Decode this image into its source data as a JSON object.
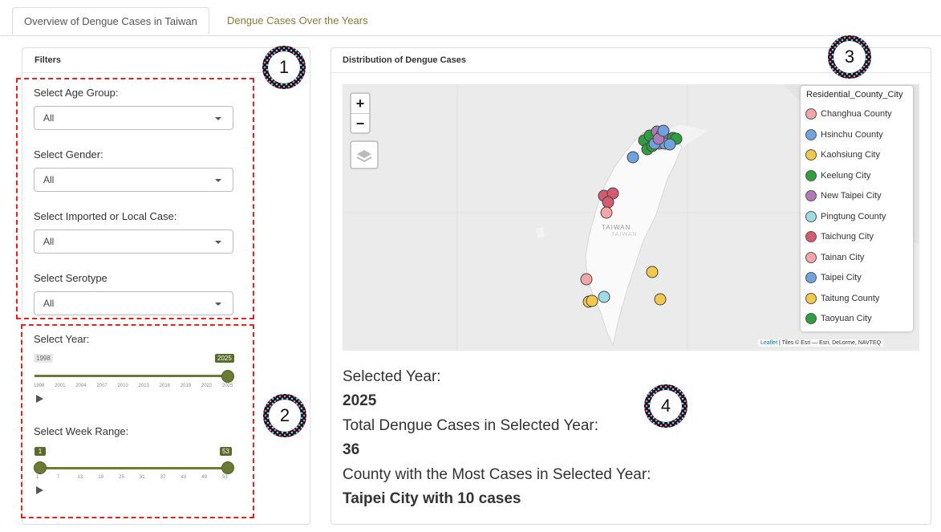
{
  "tabs": [
    {
      "label": "Overview of Dengue Cases in Taiwan",
      "active": true
    },
    {
      "label": "Dengue Cases Over the Years",
      "active": false
    }
  ],
  "filters": {
    "title": "Filters",
    "age_group": {
      "label": "Select Age Group:",
      "value": "All"
    },
    "gender": {
      "label": "Select Gender:",
      "value": "All"
    },
    "case_type": {
      "label": "Select Imported or Local Case:",
      "value": "All"
    },
    "serotype": {
      "label": "Select Serotype",
      "value": "All"
    }
  },
  "year_slider": {
    "label": "Select Year:",
    "min": "1998",
    "value": "2025",
    "ticks": [
      "1998",
      "2001",
      "2004",
      "2007",
      "2010",
      "2013",
      "2016",
      "2019",
      "2022",
      "2025"
    ]
  },
  "week_slider": {
    "label": "Select Week Range:",
    "from": "1",
    "to": "53",
    "ticks": [
      "1",
      "7",
      "13",
      "19",
      "25",
      "31",
      "37",
      "43",
      "49",
      "53"
    ]
  },
  "map_panel": {
    "title": "Distribution of Dengue Cases",
    "zoom_in": "+",
    "zoom_out": "−",
    "place_label": "TAIWAN",
    "place_label_sub": "TAIWAN",
    "attribution_leaflet": "Leaflet",
    "attribution_rest": " | Tiles © Esri — Esri, DeLorme, NAVTEQ",
    "legend": {
      "title": "Residential_County_City",
      "items": [
        {
          "label": "Changhua County",
          "color": "#f4a6a6"
        },
        {
          "label": "Hsinchu County",
          "color": "#6fa3e0"
        },
        {
          "label": "Kaohsiung City",
          "color": "#f2c94c"
        },
        {
          "label": "Keelung City",
          "color": "#2e9e3e"
        },
        {
          "label": "New Taipei City",
          "color": "#b07ab8"
        },
        {
          "label": "Pingtung County",
          "color": "#9fdde6"
        },
        {
          "label": "Taichung City",
          "color": "#d45c6e"
        },
        {
          "label": "Tainan City",
          "color": "#f4a6a6"
        },
        {
          "label": "Taipei City",
          "color": "#6fa3e0"
        },
        {
          "label": "Taitung County",
          "color": "#f2c94c"
        },
        {
          "label": "Taoyuan City",
          "color": "#2e9e3e"
        }
      ]
    }
  },
  "summary": {
    "year_label": "Selected Year:",
    "year_value": "2025",
    "total_label": "Total Dengue Cases in Selected Year:",
    "total_value": "36",
    "top_label": "County with the Most Cases in Selected Year:",
    "top_value": "Taipei City with 10 cases"
  },
  "callouts": [
    "1",
    "2",
    "3",
    "4"
  ]
}
